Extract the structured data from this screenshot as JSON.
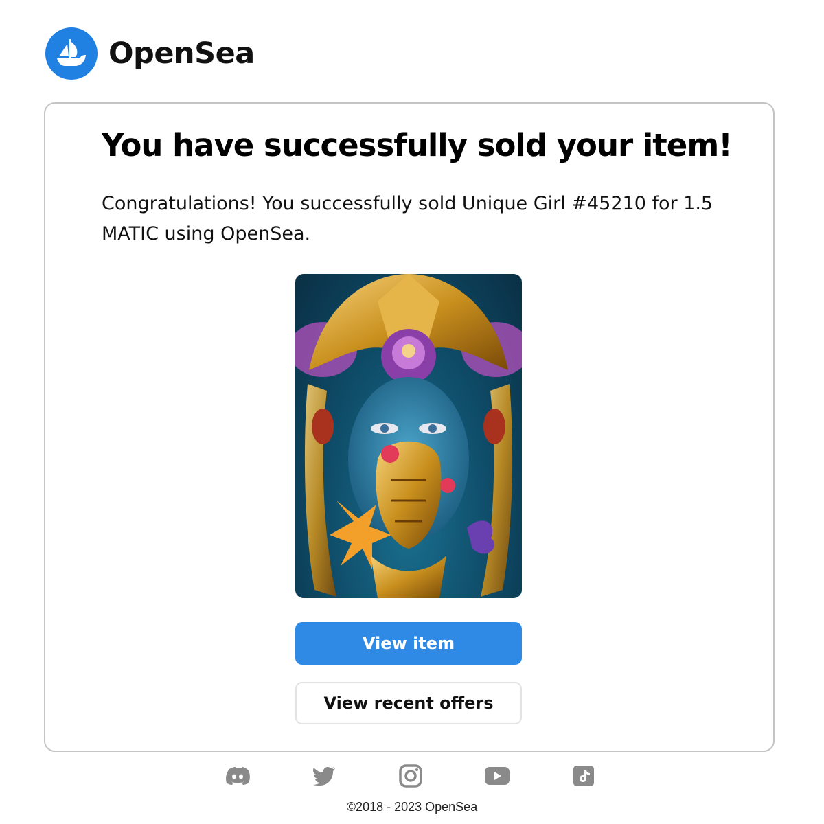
{
  "header": {
    "brand": "OpenSea",
    "logo_icon": "opensea-boat-icon"
  },
  "email": {
    "title": "You have successfully sold your item!",
    "message": "Congratulations! You successfully sold Unique Girl #45210 for 1.5 MATIC using OpenSea.",
    "nft_image": "unique-girl-artwork-image",
    "buttons": {
      "view_item": "View item",
      "view_offers": "View recent offers"
    }
  },
  "social": [
    {
      "name": "discord-icon"
    },
    {
      "name": "twitter-icon"
    },
    {
      "name": "instagram-icon"
    },
    {
      "name": "youtube-icon"
    },
    {
      "name": "tiktok-icon"
    }
  ],
  "footer": {
    "copyright": "©2018 - 2023 OpenSea"
  },
  "colors": {
    "brand_blue": "#2081e2",
    "button_blue": "#2f8ae5",
    "icon_gray": "#8a8a8a"
  }
}
